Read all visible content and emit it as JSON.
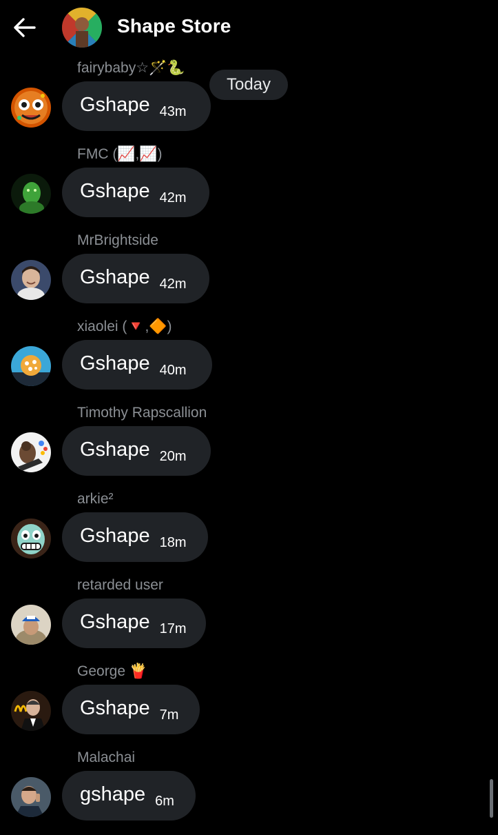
{
  "header": {
    "title": "Shape Store",
    "back_icon": "arrow-left-icon"
  },
  "date_divider": "Today",
  "messages": [
    {
      "sender": "fairybaby☆🪄🐍",
      "text": "Gshape",
      "time": "43m"
    },
    {
      "sender": "FMC (📈,📈)",
      "text": "Gshape",
      "time": "42m"
    },
    {
      "sender": "MrBrightside",
      "text": "Gshape",
      "time": "42m"
    },
    {
      "sender": "xiaolei (🔻,🔶)",
      "text": "Gshape",
      "time": "40m"
    },
    {
      "sender": "Timothy Rapscallion",
      "text": "Gshape",
      "time": "20m"
    },
    {
      "sender": "arkie²",
      "text": "Gshape",
      "time": "18m"
    },
    {
      "sender": "retarded user",
      "text": "Gshape",
      "time": "17m"
    },
    {
      "sender": "George 🍟",
      "text": "Gshape",
      "time": "7m"
    },
    {
      "sender": "Malachai",
      "text": "gshape",
      "time": "6m"
    }
  ],
  "colors": {
    "background": "#000000",
    "bubble": "#202327",
    "sender_text": "#8b8f94",
    "text": "#ffffff"
  }
}
